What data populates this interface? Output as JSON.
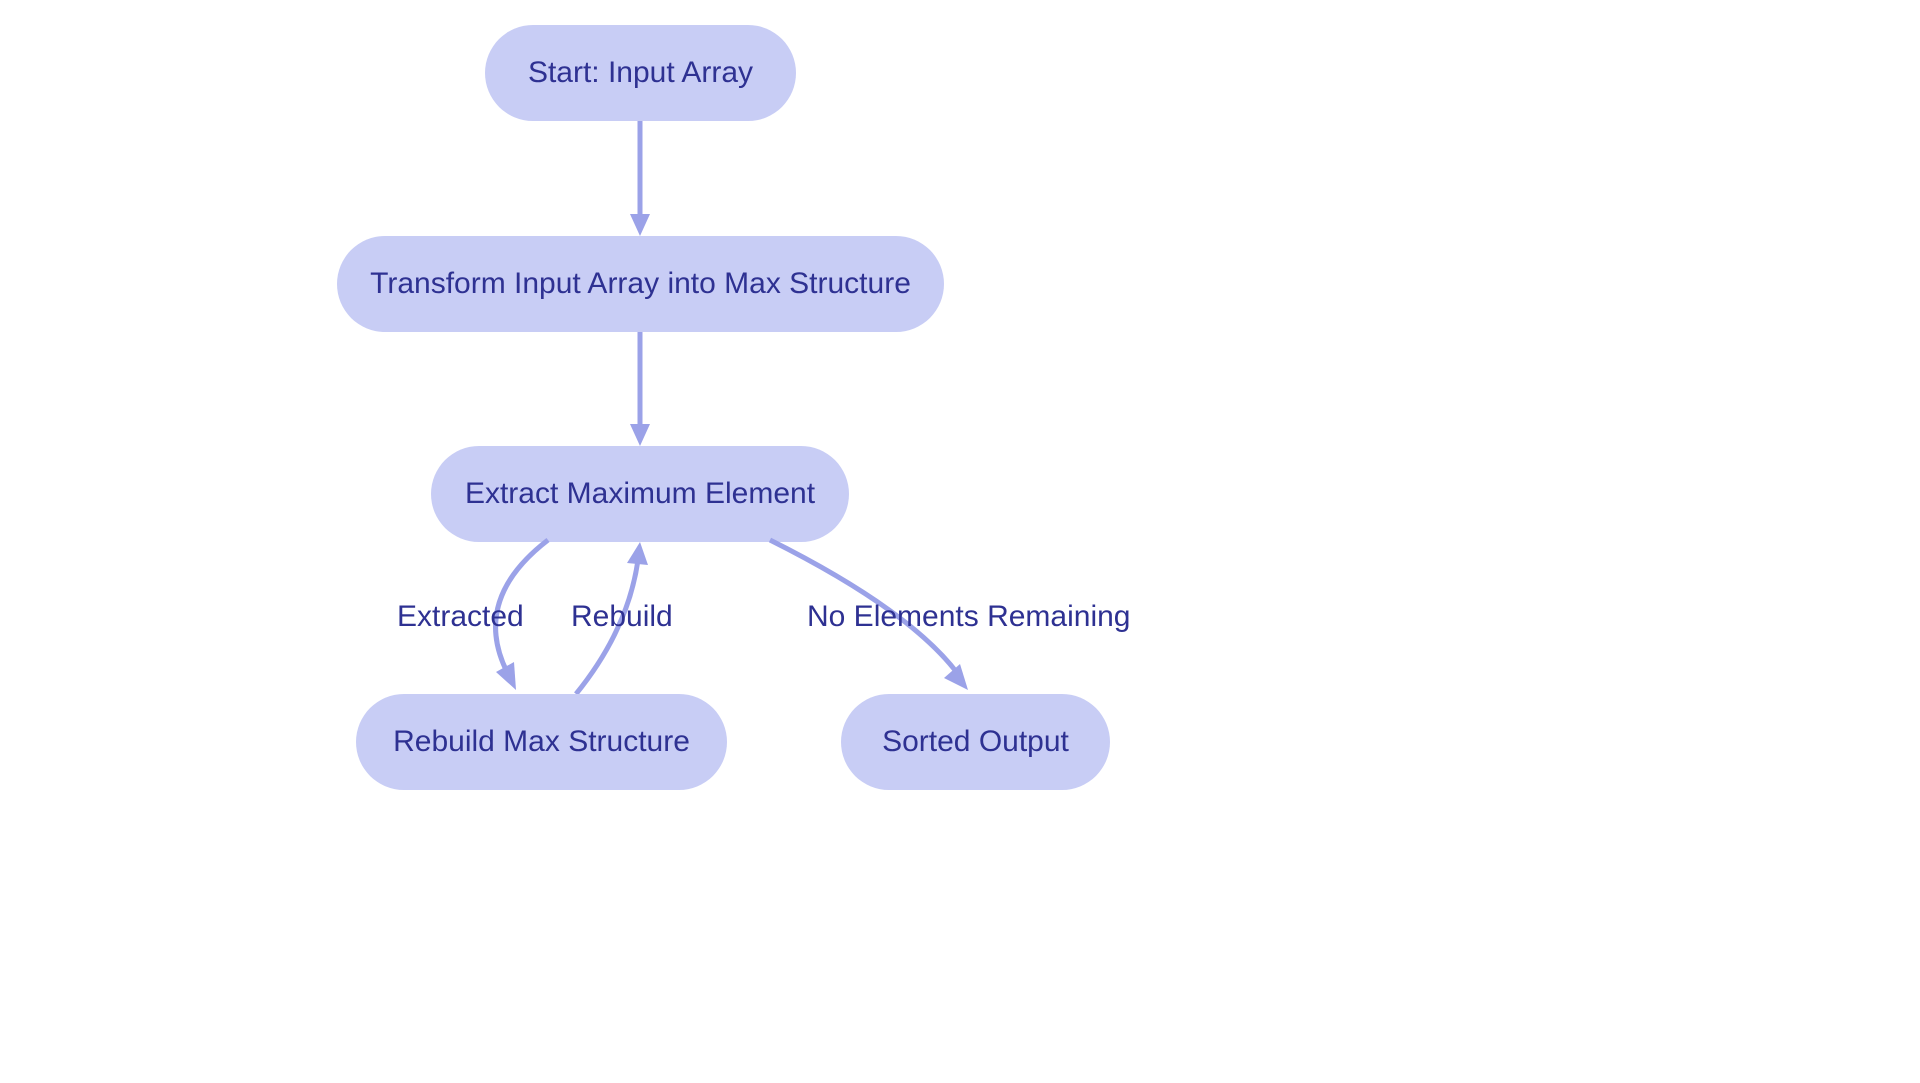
{
  "nodes": {
    "start": {
      "label": "Start: Input Array"
    },
    "transform": {
      "label": "Transform Input Array into Max Structure"
    },
    "extract": {
      "label": "Extract Maximum Element"
    },
    "rebuild": {
      "label": "Rebuild Max Structure"
    },
    "output": {
      "label": "Sorted Output"
    }
  },
  "edges": {
    "extracted": {
      "label": "Extracted"
    },
    "rebuild_edge": {
      "label": "Rebuild"
    },
    "no_remaining": {
      "label": "No Elements Remaining"
    }
  },
  "colors": {
    "node_bg": "#c8cdf5",
    "text": "#2e3192",
    "arrow": "#9ba2e8"
  }
}
